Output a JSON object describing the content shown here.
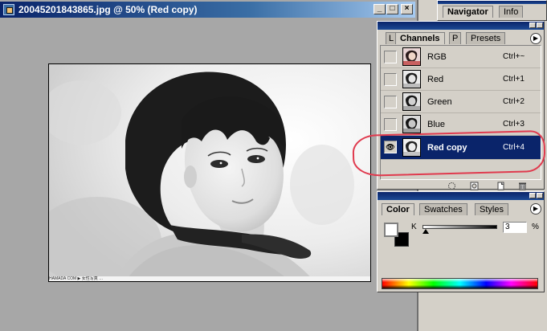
{
  "window": {
    "title": "20045201843865.jpg @ 50% (Red copy)",
    "minimize_glyph": "_",
    "maximize_glyph": "□",
    "close_glyph": "×"
  },
  "canvas": {
    "caption": "HAMADA COM  ▶ 女性写真 …"
  },
  "navigator_panel": {
    "tabs": [
      "Navigator",
      "Info"
    ]
  },
  "channels_panel": {
    "tabs": [
      "L",
      "Channels",
      "P",
      "Presets"
    ],
    "menu_glyph": "▶",
    "channels": [
      {
        "name": "RGB",
        "shortcut": "Ctrl+~",
        "visible": false,
        "selected": false,
        "thumb": "rgb"
      },
      {
        "name": "Red",
        "shortcut": "Ctrl+1",
        "visible": false,
        "selected": false,
        "thumb": "gray"
      },
      {
        "name": "Green",
        "shortcut": "Ctrl+2",
        "visible": false,
        "selected": false,
        "thumb": "gray"
      },
      {
        "name": "Blue",
        "shortcut": "Ctrl+3",
        "visible": false,
        "selected": false,
        "thumb": "gray"
      },
      {
        "name": "Red copy",
        "shortcut": "Ctrl+4",
        "visible": true,
        "selected": true,
        "thumb": "gray"
      }
    ],
    "eye_glyph": "👁",
    "bottom_icons": [
      "load-selection-icon",
      "save-selection-icon",
      "new-channel-icon",
      "trash-icon"
    ]
  },
  "color_panel": {
    "tabs": [
      "Color",
      "Swatches",
      "Styles"
    ],
    "menu_glyph": "▶",
    "k_label": "K",
    "k_value": "3",
    "percent_label": "%",
    "k_level_percent": 3,
    "foreground_color": "#ffffff",
    "background_color": "#000000"
  },
  "colors": {
    "title_active": "#0a246a",
    "selection": "#0a246a",
    "annotation": "#e03a4e"
  }
}
